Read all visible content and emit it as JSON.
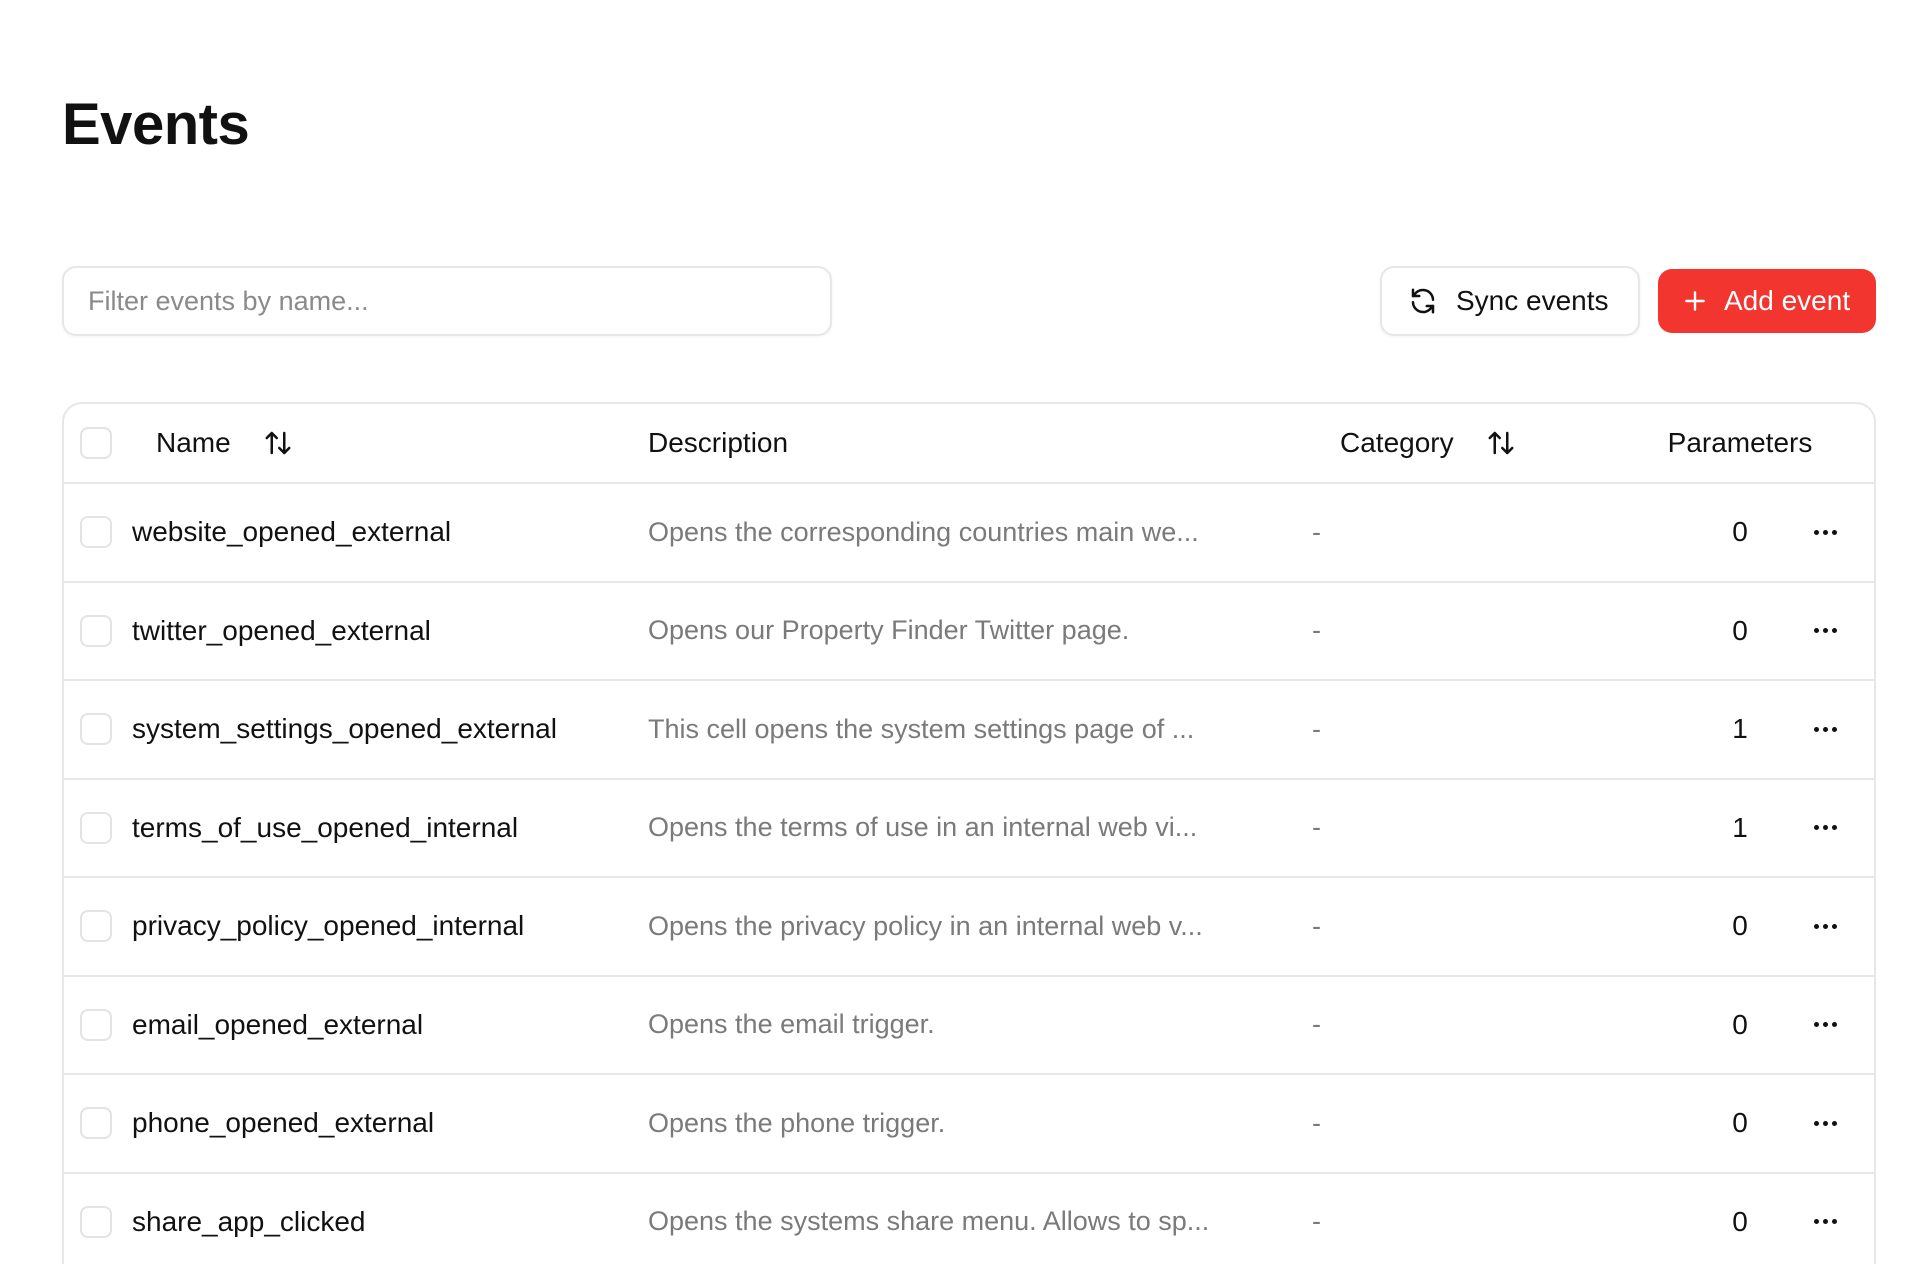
{
  "header": {
    "title": "Events"
  },
  "toolbar": {
    "search_placeholder": "Filter events by name...",
    "sync_label": "Sync events",
    "add_label": "Add event",
    "accent_color": "#f2362f"
  },
  "table": {
    "columns": {
      "name": "Name",
      "description": "Description",
      "category": "Category",
      "parameters": "Parameters"
    },
    "rows": [
      {
        "name": "website_opened_external",
        "description": "Opens the corresponding countries main we...",
        "category": "-",
        "parameters": "0"
      },
      {
        "name": "twitter_opened_external",
        "description": "Opens our Property Finder Twitter page.",
        "category": "-",
        "parameters": "0"
      },
      {
        "name": "system_settings_opened_external",
        "description": "This cell opens the system settings page of ...",
        "category": "-",
        "parameters": "1"
      },
      {
        "name": "terms_of_use_opened_internal",
        "description": "Opens the terms of use in an internal web vi...",
        "category": "-",
        "parameters": "1"
      },
      {
        "name": "privacy_policy_opened_internal",
        "description": "Opens the privacy policy in an internal web v...",
        "category": "-",
        "parameters": "0"
      },
      {
        "name": "email_opened_external",
        "description": "Opens the email trigger.",
        "category": "-",
        "parameters": "0"
      },
      {
        "name": "phone_opened_external",
        "description": "Opens the phone trigger.",
        "category": "-",
        "parameters": "0"
      },
      {
        "name": "share_app_clicked",
        "description": "Opens the systems share menu. Allows to sp...",
        "category": "-",
        "parameters": "0"
      }
    ]
  },
  "icons": {
    "sort": "sort-arrows-icon",
    "sync": "refresh-icon",
    "add": "plus-icon",
    "more": "more-horizontal-icon"
  }
}
